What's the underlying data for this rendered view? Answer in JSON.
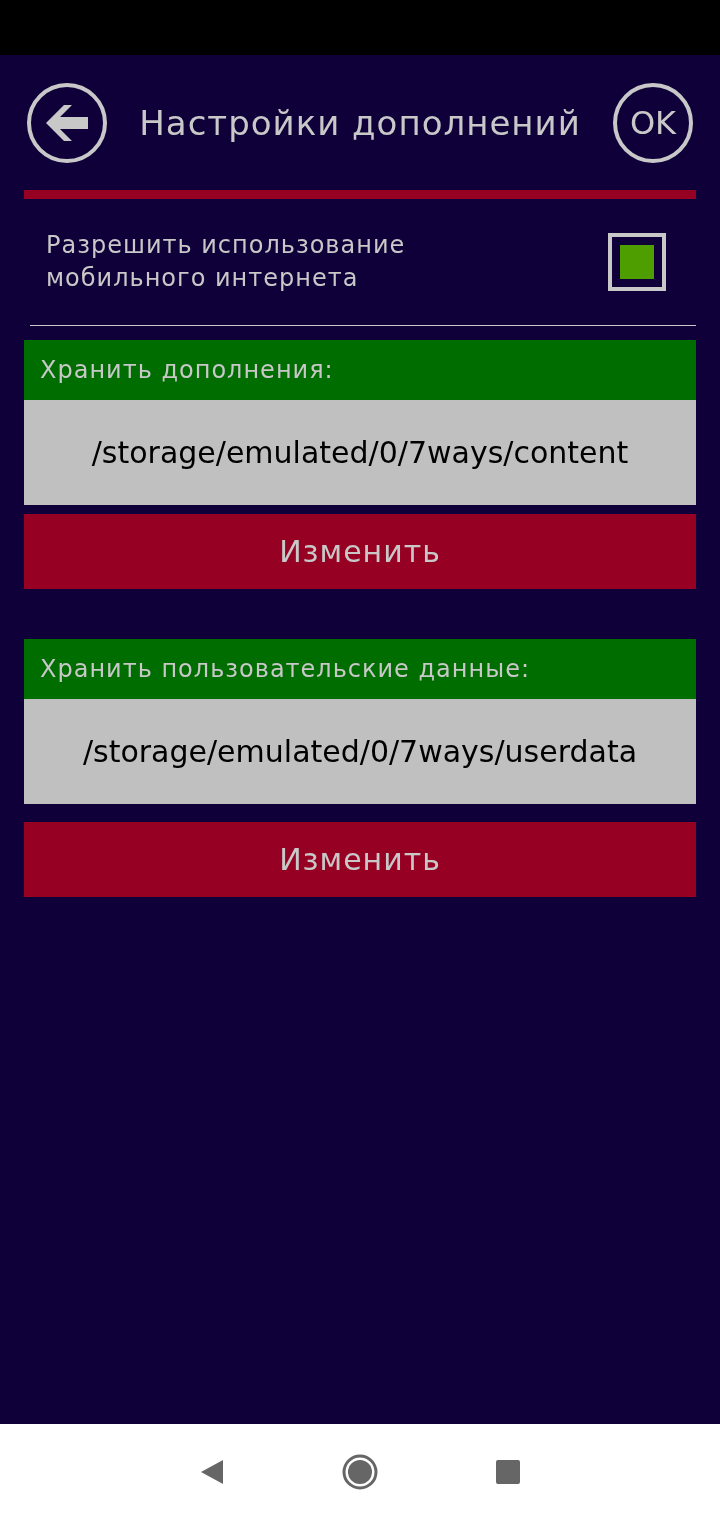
{
  "header": {
    "title": "Настройки дополнений",
    "ok_button": "OK"
  },
  "mobile_internet": {
    "label": "Разрешить использование мобильного интернета",
    "checked": true
  },
  "storage": [
    {
      "label": "Хранить дополнения:",
      "path": "/storage/emulated/0/7ways/content",
      "button": "Изменить"
    },
    {
      "label": "Хранить пользовательские данные:",
      "path": "/storage/emulated/0/7ways/userdata",
      "button": "Изменить"
    }
  ]
}
